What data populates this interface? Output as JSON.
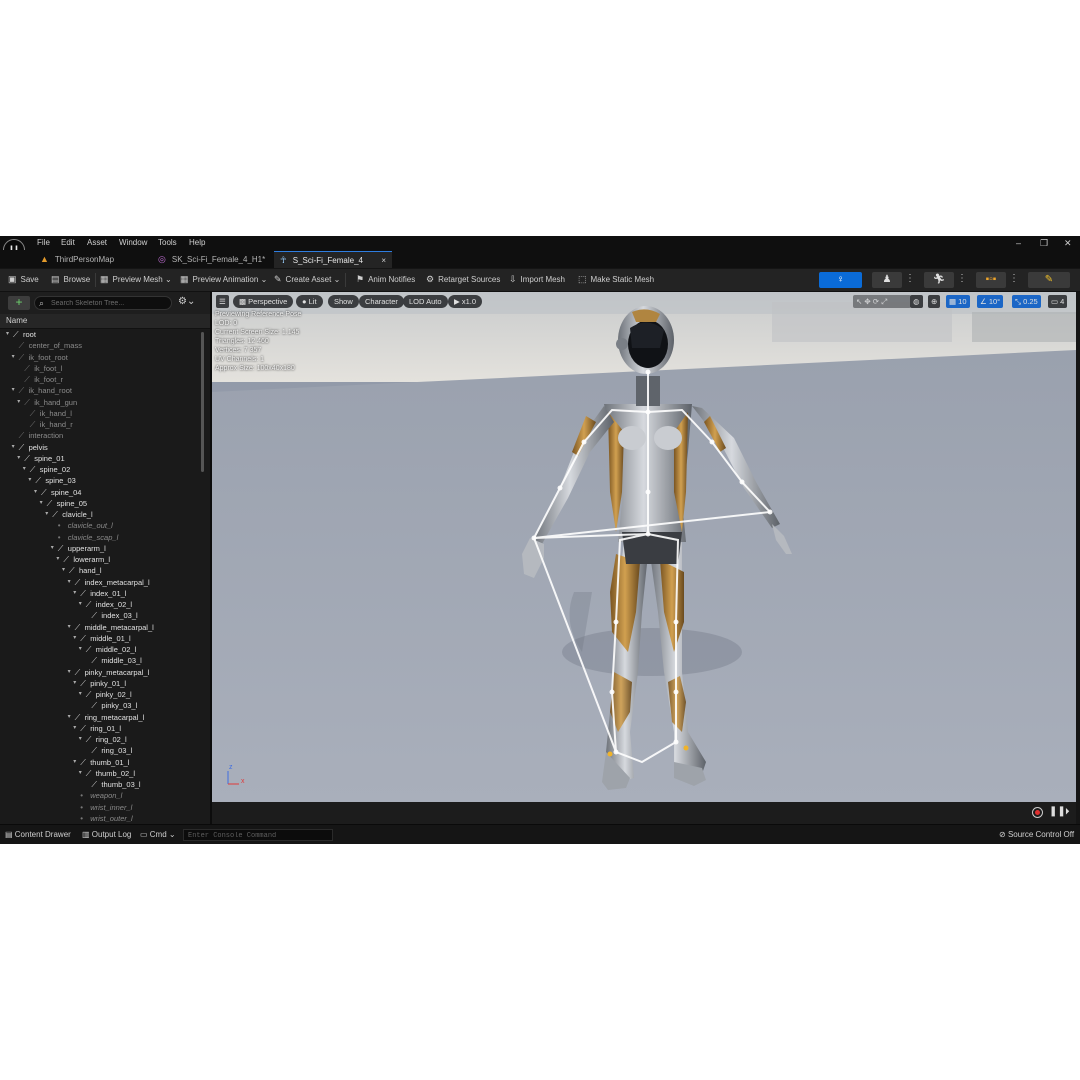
{
  "menu": [
    "File",
    "Edit",
    "Asset",
    "Window",
    "Tools",
    "Help"
  ],
  "tabs": [
    {
      "label": "ThirdPersonMap",
      "icon": "map-icon"
    },
    {
      "label": "SK_Sci-Fi_Female_4_H1*",
      "icon": "skeletal-mesh-icon"
    },
    {
      "label": "S_Sci-Fi_Female_4",
      "icon": "skeleton-icon",
      "active": true,
      "close": "×"
    }
  ],
  "toolbar": {
    "save": "Save",
    "browse": "Browse",
    "preview_mesh": "Preview Mesh",
    "preview_animation": "Preview Animation",
    "create_asset": "Create Asset",
    "anim_notifies": "Anim Notifies",
    "retarget_sources": "Retarget Sources",
    "import_mesh": "Import Mesh",
    "make_static_mesh": "Make Static Mesh"
  },
  "skeleton_tree": {
    "search_placeholder": "Search Skeleton Tree...",
    "column_name": "Name",
    "bones": [
      {
        "name": "root",
        "depth": 0,
        "type": "bone",
        "expanded": true
      },
      {
        "name": "center_of_mass",
        "depth": 1,
        "type": "dim"
      },
      {
        "name": "ik_foot_root",
        "depth": 1,
        "type": "dim",
        "expanded": true
      },
      {
        "name": "ik_foot_l",
        "depth": 2,
        "type": "dim"
      },
      {
        "name": "ik_foot_r",
        "depth": 2,
        "type": "dim"
      },
      {
        "name": "ik_hand_root",
        "depth": 1,
        "type": "dim",
        "expanded": true
      },
      {
        "name": "ik_hand_gun",
        "depth": 2,
        "type": "dim",
        "expanded": true
      },
      {
        "name": "ik_hand_l",
        "depth": 3,
        "type": "dim"
      },
      {
        "name": "ik_hand_r",
        "depth": 3,
        "type": "dim"
      },
      {
        "name": "interaction",
        "depth": 1,
        "type": "dim"
      },
      {
        "name": "pelvis",
        "depth": 1,
        "type": "bone",
        "expanded": true
      },
      {
        "name": "spine_01",
        "depth": 2,
        "type": "bone",
        "expanded": true
      },
      {
        "name": "spine_02",
        "depth": 3,
        "type": "bone",
        "expanded": true
      },
      {
        "name": "spine_03",
        "depth": 4,
        "type": "bone",
        "expanded": true
      },
      {
        "name": "spine_04",
        "depth": 5,
        "type": "bone",
        "expanded": true
      },
      {
        "name": "spine_05",
        "depth": 6,
        "type": "bone",
        "expanded": true
      },
      {
        "name": "clavicle_l",
        "depth": 7,
        "type": "bone",
        "expanded": true
      },
      {
        "name": "clavicle_out_l",
        "depth": 8,
        "type": "socket"
      },
      {
        "name": "clavicle_scap_l",
        "depth": 8,
        "type": "socket"
      },
      {
        "name": "upperarm_l",
        "depth": 8,
        "type": "bone",
        "expanded": true
      },
      {
        "name": "lowerarm_l",
        "depth": 9,
        "type": "bone",
        "expanded": true
      },
      {
        "name": "hand_l",
        "depth": 10,
        "type": "bone",
        "expanded": true
      },
      {
        "name": "index_metacarpal_l",
        "depth": 11,
        "type": "bone",
        "expanded": true
      },
      {
        "name": "index_01_l",
        "depth": 12,
        "type": "bone",
        "expanded": true
      },
      {
        "name": "index_02_l",
        "depth": 13,
        "type": "bone",
        "expanded": true
      },
      {
        "name": "index_03_l",
        "depth": 14,
        "type": "bone"
      },
      {
        "name": "middle_metacarpal_l",
        "depth": 11,
        "type": "bone",
        "expanded": true
      },
      {
        "name": "middle_01_l",
        "depth": 12,
        "type": "bone",
        "expanded": true
      },
      {
        "name": "middle_02_l",
        "depth": 13,
        "type": "bone",
        "expanded": true
      },
      {
        "name": "middle_03_l",
        "depth": 14,
        "type": "bone"
      },
      {
        "name": "pinky_metacarpal_l",
        "depth": 11,
        "type": "bone",
        "expanded": true
      },
      {
        "name": "pinky_01_l",
        "depth": 12,
        "type": "bone",
        "expanded": true
      },
      {
        "name": "pinky_02_l",
        "depth": 13,
        "type": "bone",
        "expanded": true
      },
      {
        "name": "pinky_03_l",
        "depth": 14,
        "type": "bone"
      },
      {
        "name": "ring_metacarpal_l",
        "depth": 11,
        "type": "bone",
        "expanded": true
      },
      {
        "name": "ring_01_l",
        "depth": 12,
        "type": "bone",
        "expanded": true
      },
      {
        "name": "ring_02_l",
        "depth": 13,
        "type": "bone",
        "expanded": true
      },
      {
        "name": "ring_03_l",
        "depth": 14,
        "type": "bone"
      },
      {
        "name": "thumb_01_l",
        "depth": 12,
        "type": "bone",
        "expanded": true
      },
      {
        "name": "thumb_02_l",
        "depth": 13,
        "type": "bone",
        "expanded": true
      },
      {
        "name": "thumb_03_l",
        "depth": 14,
        "type": "bone"
      },
      {
        "name": "weapon_l",
        "depth": 12,
        "type": "socket"
      },
      {
        "name": "wrist_inner_l",
        "depth": 12,
        "type": "socket"
      },
      {
        "name": "wrist_outer_l",
        "depth": 12,
        "type": "socket"
      }
    ]
  },
  "viewport": {
    "perspective": "Perspective",
    "lit": "Lit",
    "show": "Show",
    "character": "Character",
    "lod": "LOD Auto",
    "speed": "x1.0",
    "grid_size": "10",
    "rotation_snap": "10°",
    "scale_snap": "0.25",
    "camera_speed": "4",
    "stats": [
      "Previewing Reference Pose",
      "LOD: 0",
      "Current Screen Size: 1.145",
      "Triangles: 12 460",
      "Vertices: 7 357",
      "UV Channels: 1",
      "Approx Size: 100x40x180"
    ],
    "axis_z": "z",
    "axis_x": "x"
  },
  "statusbar": {
    "content_drawer": "Content Drawer",
    "output_log": "Output Log",
    "cmd": "Cmd",
    "console_placeholder": "Enter Console Command",
    "source_control": "Source Control Off"
  },
  "colors": {
    "accent": "#0a6bd8",
    "panel": "#1a1a1a",
    "viewport_floor": "#9aa1ae",
    "suit_gold": "#b8873a",
    "suit_silver": "#c9cdd3"
  }
}
